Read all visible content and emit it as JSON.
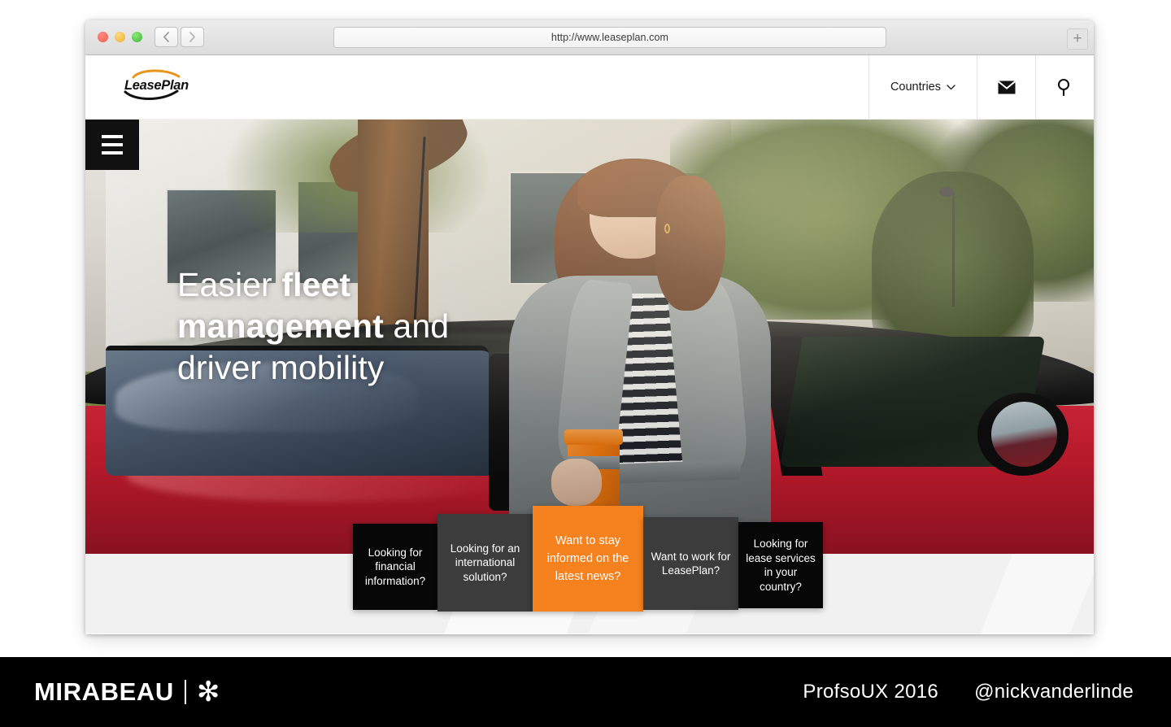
{
  "browser": {
    "url": "http://www.leaseplan.com",
    "traffic_lights": [
      "close-red",
      "minimize-yellow",
      "zoom-green"
    ],
    "back_label": "‹",
    "forward_label": "›",
    "new_tab_label": "+",
    "colors": {
      "red": "#ec5f55",
      "yellow": "#e8b131",
      "green": "#3db83a"
    }
  },
  "site": {
    "logo_text": "LeasePlan",
    "header": {
      "countries_label": "Countries",
      "countries_chevron": "ˇ",
      "mail_icon": "envelope-icon",
      "search_icon": "search-icon"
    },
    "menu_button": "hamburger-menu-icon",
    "hero": {
      "headline_part1": "Easier ",
      "headline_bold": "fleet management",
      "headline_part2": " and driver mobility",
      "headline_plain": "Easier fleet management and driver mobility"
    },
    "cta_tiles": [
      {
        "label": "Looking for financial information?",
        "color": "#070707"
      },
      {
        "label": "Looking for an international solution?",
        "color": "#3c3c3c"
      },
      {
        "label": "Want to stay informed on the latest news?",
        "color": "#f5821f"
      },
      {
        "label": "Want to work for LeasePlan?",
        "color": "#3c3c3c"
      },
      {
        "label": "Looking for lease services in your country?",
        "color": "#070707"
      }
    ]
  },
  "footer": {
    "brand": "MIRABEAU",
    "brand_star": "✻",
    "event": "ProfsoUX 2016",
    "handle": "@nickvanderlinde",
    "background": "#000000"
  }
}
